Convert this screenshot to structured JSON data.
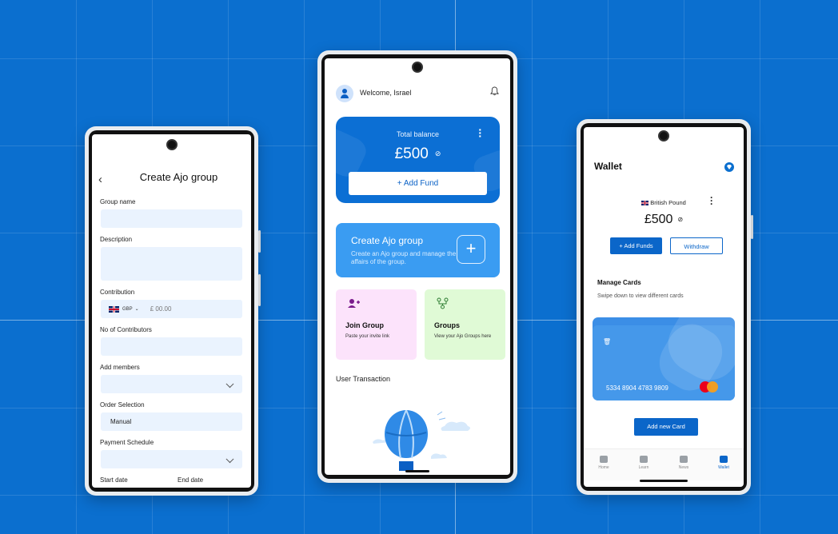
{
  "left_screen": {
    "title": "Create Ajo group",
    "back_icon": "chevron-left-icon",
    "fields": {
      "group_name": {
        "label": "Group name",
        "value": ""
      },
      "description": {
        "label": "Description",
        "value": ""
      },
      "contribution": {
        "label": "Contribution",
        "currency_code": "GBP",
        "amount_placeholder": "£ 00.00"
      },
      "no_of_contributors": {
        "label": "No of Contributors",
        "value": ""
      },
      "add_members": {
        "label": "Add members",
        "value": ""
      },
      "order_selection": {
        "label": "Order Selection",
        "value": "Manual"
      },
      "payment_schedule": {
        "label": "Payment Schedule",
        "value": ""
      },
      "start_date": {
        "label": "Start date"
      },
      "end_date": {
        "label": "End date"
      }
    }
  },
  "center_screen": {
    "welcome": "Welcome, Israel",
    "balance": {
      "title": "Total balance",
      "amount": "£500",
      "add_fund_label": "+ Add Fund"
    },
    "create_group": {
      "title": "Create Ajo group",
      "subtitle": "Create an Ajo group and manage the affairs of the group."
    },
    "join_group": {
      "title": "Join Group",
      "subtitle": "Paste your invite link"
    },
    "groups": {
      "title": "Groups",
      "subtitle": "View your Ajo Groups here"
    },
    "user_transaction": "User Transaction",
    "colors": {
      "primary": "#0c6fd4",
      "accent": "#3a9cf2",
      "join_bg": "#fce3fb",
      "groups_bg": "#e0fad6"
    }
  },
  "right_screen": {
    "title": "Wallet",
    "currency": "British Pound",
    "amount": "£500",
    "add_funds_label": "+ Add Funds",
    "withdraw_label": "Withdraw",
    "manage_cards": "Manage Cards",
    "swipe_hint": "Swipe down to view different cards",
    "card_number": "5334 8904 4783 9809",
    "card_brand": "mastercard-icon",
    "add_card_label": "Add new Card",
    "tabs": [
      {
        "label": "Home",
        "icon": "home-icon"
      },
      {
        "label": "Learn",
        "icon": "book-icon"
      },
      {
        "label": "News",
        "icon": "news-icon"
      },
      {
        "label": "Wallet",
        "icon": "wallet-icon"
      }
    ]
  },
  "colors": {
    "background": "#0b6fcf",
    "field_bg": "#eaf3fe"
  }
}
